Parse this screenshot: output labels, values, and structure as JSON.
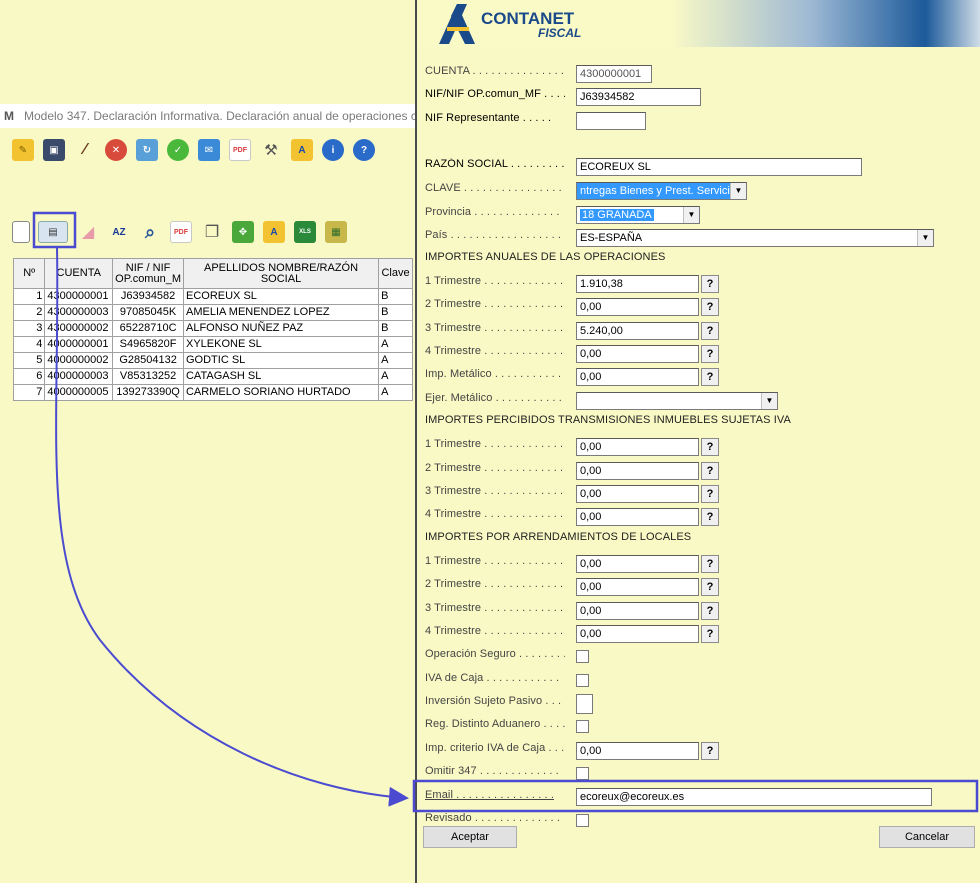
{
  "window": {
    "app_icon": "M",
    "title": "Modelo 347. Declaración Informativa. Declaración anual de operaciones co"
  },
  "toolbar1": {
    "icons": [
      "edit-icon",
      "save-icon",
      "magic-wand-icon",
      "cancel-icon",
      "refresh-icon",
      "accept-icon",
      "email-icon",
      "pdf-icon",
      "tools-icon",
      "tax-agency-icon",
      "info-icon",
      "help-icon"
    ],
    "glyphs": [
      "✎",
      "▣",
      "⁄",
      "✕",
      "↻",
      "✓",
      "✉",
      "PDF",
      "⚒",
      "A",
      "i",
      "?"
    ]
  },
  "toolbar2": {
    "icons": [
      "new-document-icon",
      "contact-card-icon",
      "eraser-icon",
      "sort-az-icon",
      "search-icon",
      "pdf-icon",
      "copy-icon",
      "expand-icon",
      "tax-agency-icon",
      "excel-icon",
      "import-icon"
    ],
    "glyphs": [
      "▯",
      "▤",
      "◢",
      "AZ",
      "⌕",
      "PDF",
      "❐",
      "✥",
      "A",
      "XLS",
      "▦"
    ]
  },
  "table": {
    "headers": [
      "Nº",
      "CUENTA",
      "NIF / NIF OP.comun_M",
      "APELLIDOS NOMBRE/RAZÓN SOCIAL",
      "Clave"
    ],
    "rows": [
      [
        "1",
        "4300000001",
        "J63934582",
        "ECOREUX SL",
        "B"
      ],
      [
        "2",
        "4300000003",
        "97085045K",
        "AMELIA MENENDEZ LOPEZ",
        "B"
      ],
      [
        "3",
        "4300000002",
        "65228710C",
        "ALFONSO NUÑEZ PAZ",
        "B"
      ],
      [
        "4",
        "4000000001",
        "S4965820F",
        "XYLEKONE SL",
        "A"
      ],
      [
        "5",
        "4000000002",
        "G28504132",
        "GODTIC SL",
        "A"
      ],
      [
        "6",
        "4000000003",
        "V85313252",
        "CATAGASH SL",
        "A"
      ],
      [
        "7",
        "4000000005",
        "139273390Q",
        "CARMELO SORIANO HURTADO",
        "A"
      ]
    ]
  },
  "logo": {
    "brand": "CONTANET",
    "product": "FISCAL"
  },
  "form": {
    "cuenta_label": "CUENTA . . . . . . . . . . . . . . .",
    "cuenta_value": "4300000001",
    "nif_label": "NIF/NIF OP.comun_MF . . . .",
    "nif_value": "J63934582",
    "nif_rep_label": "NIF Representante . . . . .",
    "nif_rep_value": "",
    "razon_label": "RAZÓN SOCIAL . . . . . . . . .",
    "razon_value": "ECOREUX SL",
    "clave_label": "CLAVE . . . . . . . . . . . . . . . .",
    "clave_value": "ntregas Bienes y Prest. Servicios",
    "provincia_label": "Provincia . . . . . . . . . . . . . .",
    "provincia_value": "18 GRANADA",
    "pais_label": "País . . . . . . . . . . . . . . . . . .",
    "pais_value": "ES-ESPAÑA",
    "section1": "IMPORTES ANUALES DE LAS OPERACIONES",
    "t1_label": "1 Trimestre . . . . . . . . . . . . .",
    "t1_value": "1.910,38",
    "t2_label": "2 Trimestre . . . . . . . . . . . . .",
    "t2_value": "0,00",
    "t3_label": "3 Trimestre . . . . . . . . . . . . .",
    "t3_value": "5.240,00",
    "t4_label": "4 Trimestre . . . . . . . . . . . . .",
    "t4_value": "0,00",
    "metalico_label": "Imp. Metálico . . . . . . . . . . .",
    "metalico_value": "0,00",
    "ejer_label": "Ejer. Metálico . . . . . . . . . . .",
    "ejer_value": "",
    "section2": "IMPORTES PERCIBIDOS TRANSMISIONES INMUEBLES SUJETAS IVA",
    "s2_t1_value": "0,00",
    "s2_t2_value": "0,00",
    "s2_t3_value": "0,00",
    "s2_t4_value": "0,00",
    "section3": "IMPORTES POR ARRENDAMIENTOS DE LOCALES",
    "s3_t1_value": "0,00",
    "s3_t2_value": "0,00",
    "s3_t3_value": "0,00",
    "s3_t4_value": "0,00",
    "seguro_label": "Operación Seguro . . . . . . . .",
    "iva_caja_label": "IVA de Caja . . . . . . . . . . . .",
    "inversion_label": "Inversión Sujeto Pasivo . . . .",
    "aduanero_label": "Reg. Distinto Aduanero . . . .",
    "criterio_label": "Imp. criterio IVA de Caja . . . .",
    "criterio_value": "0,00",
    "omitir_label": "Omitir 347 . . . . . . . . . . . . .",
    "email_label": "Email . . . . . . . . . . . . . . . .",
    "email_value": "ecoreux@ecoreux.es",
    "revisado_label": "Revisado . . . . . . . . . . . . . .",
    "help_glyph": "?",
    "dropdown_glyph": "▼"
  },
  "buttons": {
    "accept": "Aceptar",
    "cancel": "Cancelar"
  },
  "colors": {
    "annotation": "#4b4bd1",
    "background": "#f9f9c5",
    "selection": "#3399ff"
  }
}
